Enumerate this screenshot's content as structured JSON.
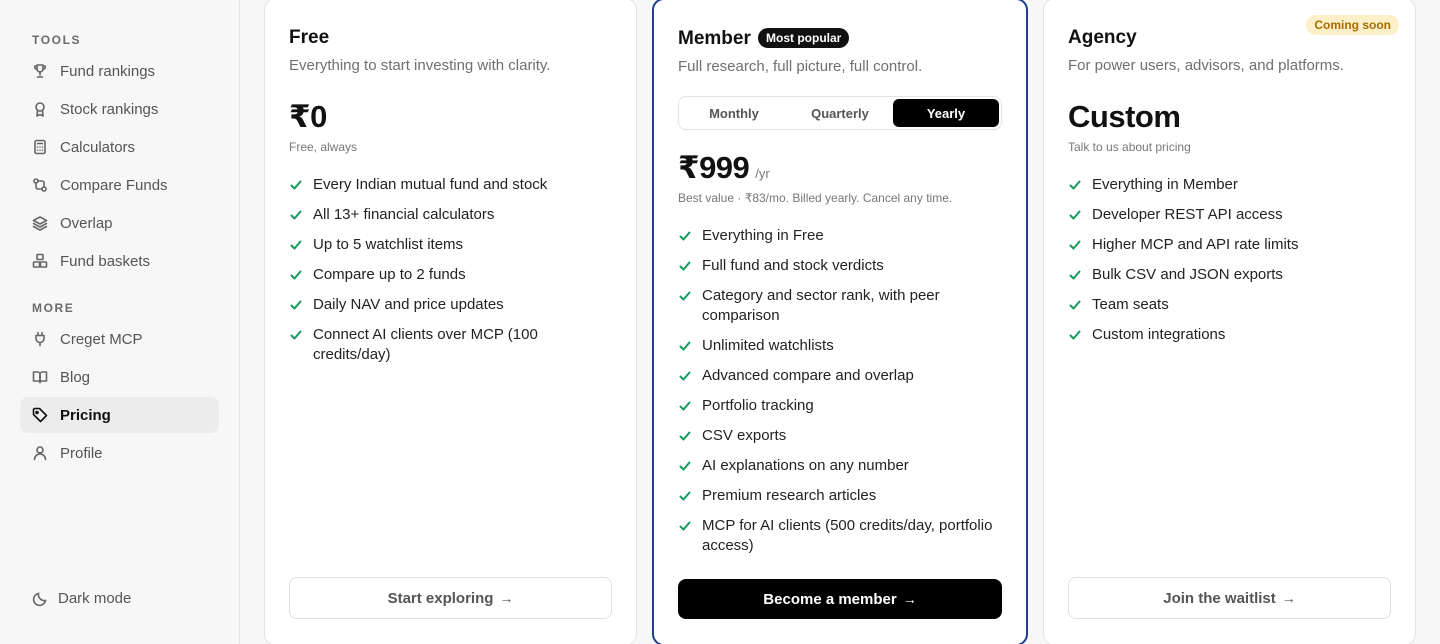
{
  "sidebar": {
    "tools_title": "TOOLS",
    "tools": [
      {
        "label": "Fund rankings",
        "icon": "trophy-icon"
      },
      {
        "label": "Stock rankings",
        "icon": "award-icon"
      },
      {
        "label": "Calculators",
        "icon": "calculator-icon"
      },
      {
        "label": "Compare Funds",
        "icon": "compare-icon"
      },
      {
        "label": "Overlap",
        "icon": "layers-icon"
      },
      {
        "label": "Fund baskets",
        "icon": "boxes-icon"
      }
    ],
    "more_title": "MORE",
    "more": [
      {
        "label": "Creget MCP",
        "icon": "plug-icon"
      },
      {
        "label": "Blog",
        "icon": "book-icon"
      },
      {
        "label": "Pricing",
        "icon": "tag-icon",
        "active": true
      },
      {
        "label": "Profile",
        "icon": "user-icon"
      }
    ],
    "dark_mode_label": "Dark mode"
  },
  "plans": {
    "free": {
      "name": "Free",
      "subtitle": "Everything to start investing with clarity.",
      "price": "₹0",
      "price_note": "Free, always",
      "features": [
        "Every Indian mutual fund and stock",
        "All 13+ financial calculators",
        "Up to 5 watchlist items",
        "Compare up to 2 funds",
        "Daily NAV and price updates",
        "Connect AI clients over MCP (100 credits/day)"
      ],
      "cta": "Start exploring"
    },
    "member": {
      "name": "Member",
      "badge": "Most popular",
      "subtitle": "Full research, full picture, full control.",
      "billing_options": [
        "Monthly",
        "Quarterly",
        "Yearly"
      ],
      "selected_billing": "Yearly",
      "price": "₹999",
      "price_unit": "/yr",
      "price_note": "Best value · ₹83/mo. Billed yearly. Cancel any time.",
      "features": [
        "Everything in Free",
        "Full fund and stock verdicts",
        "Category and sector rank, with peer comparison",
        "Unlimited watchlists",
        "Advanced compare and overlap",
        "Portfolio tracking",
        "CSV exports",
        "AI explanations on any number",
        "Premium research articles",
        "MCP for AI clients (500 credits/day, portfolio access)"
      ],
      "cta": "Become a member"
    },
    "agency": {
      "name": "Agency",
      "badge": "Coming soon",
      "subtitle": "For power users, advisors, and platforms.",
      "price": "Custom",
      "price_note": "Talk to us about pricing",
      "features": [
        "Everything in Member",
        "Developer REST API access",
        "Higher MCP and API rate limits",
        "Bulk CSV and JSON exports",
        "Team seats",
        "Custom integrations"
      ],
      "cta": "Join the waitlist"
    }
  },
  "colors": {
    "accent_border": "#1d3f8f",
    "check_green": "#159a5b",
    "coming_soon_bg": "#fdf0c8",
    "coming_soon_text": "#a86b00"
  }
}
